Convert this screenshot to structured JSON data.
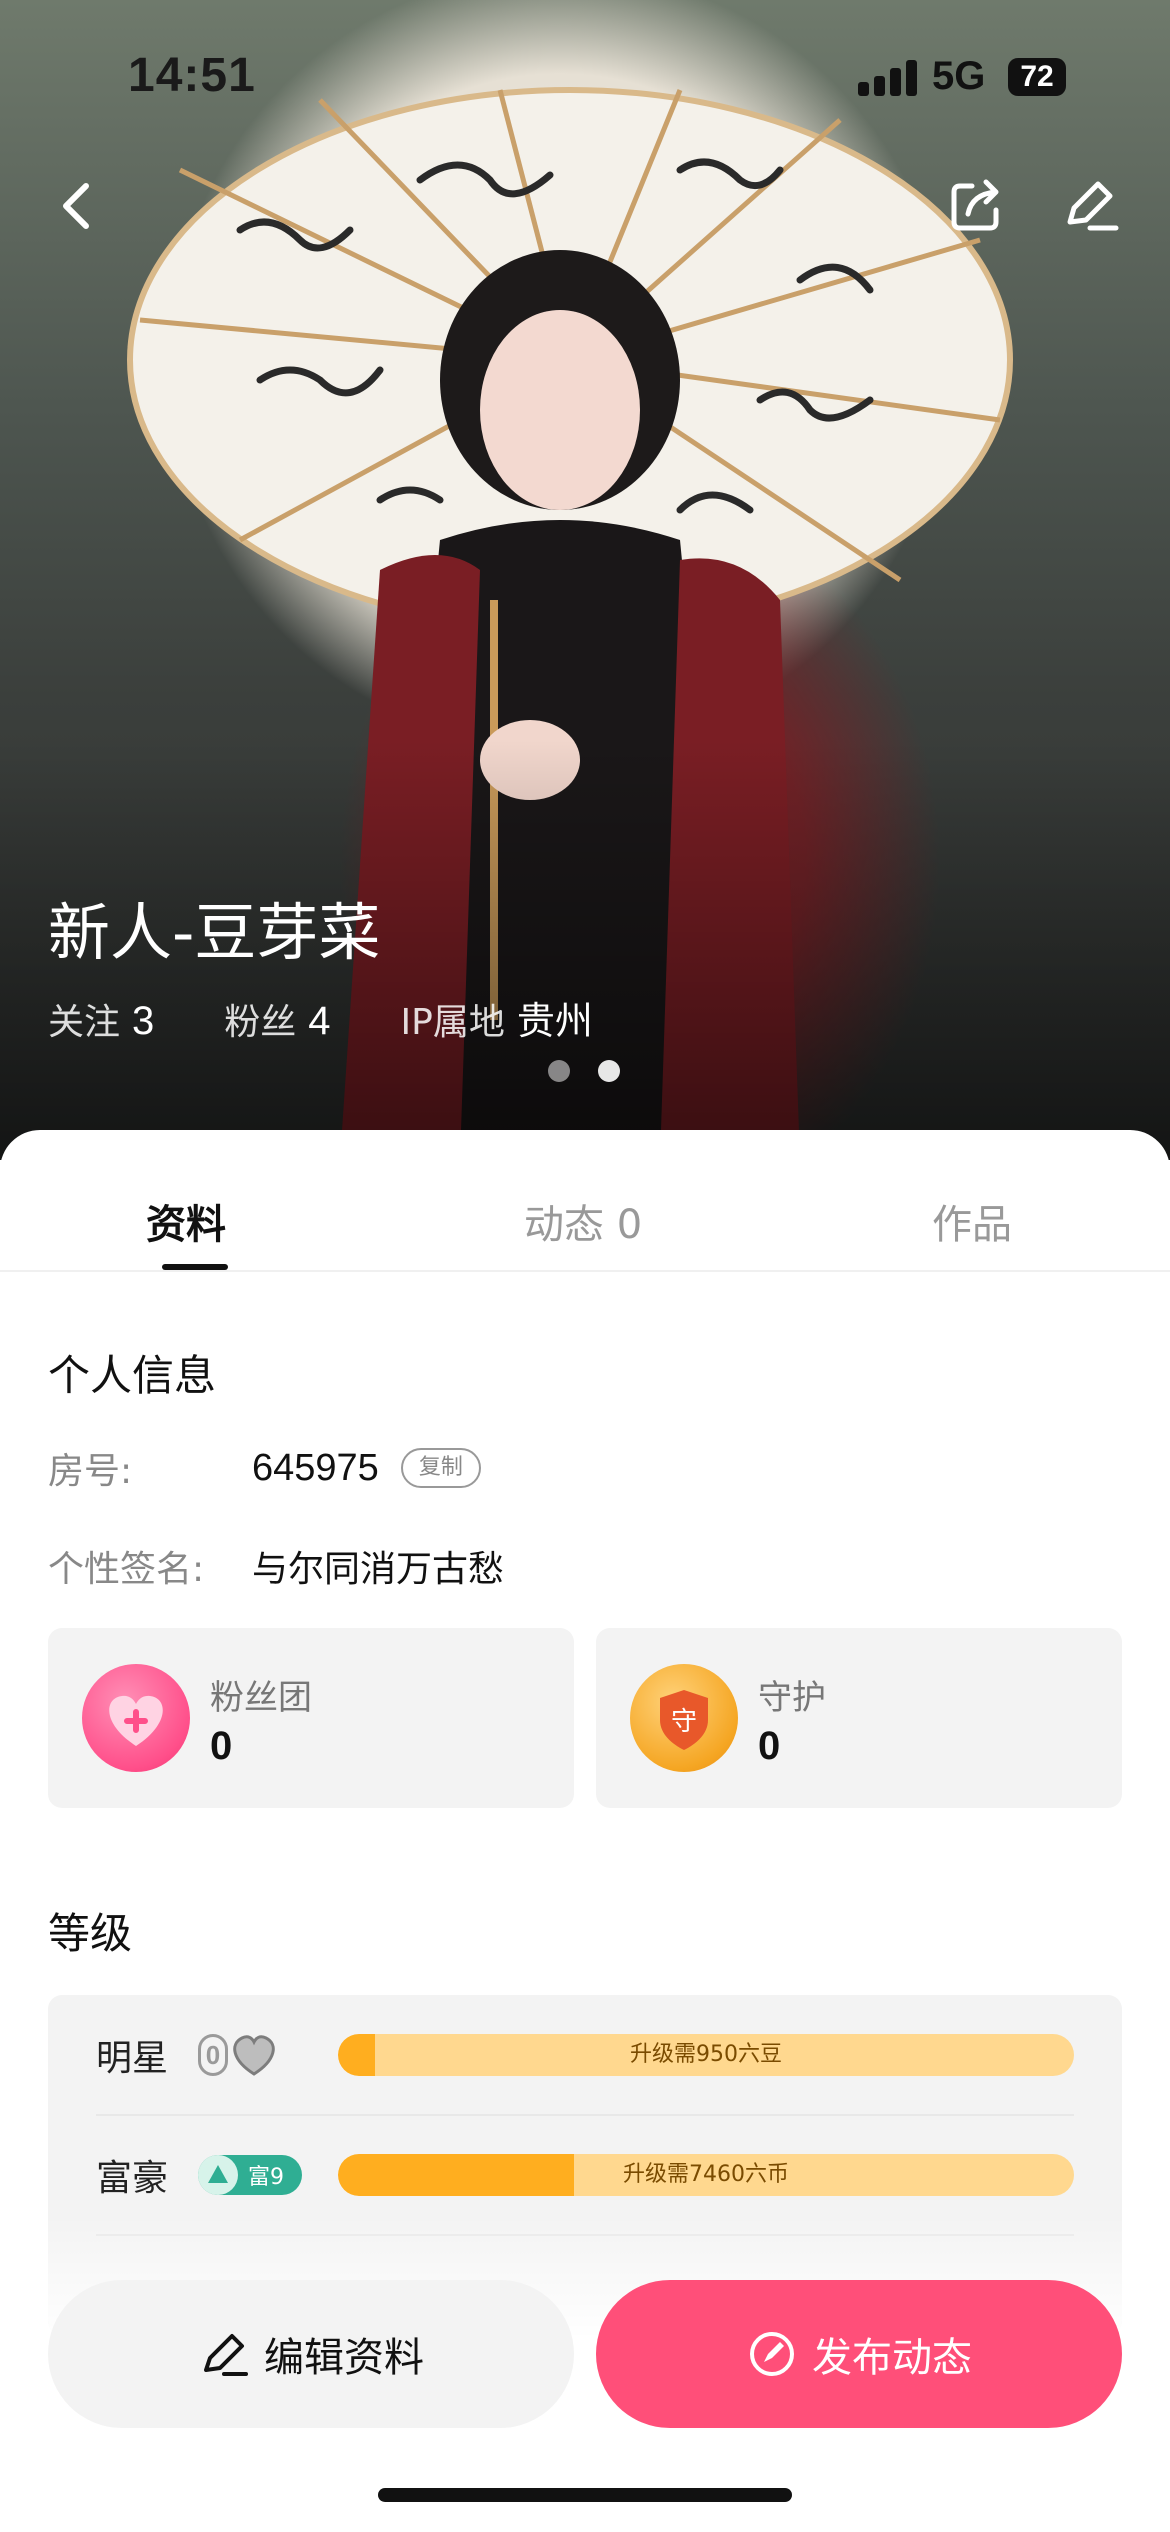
{
  "status_bar": {
    "time": "14:51",
    "network": "5G",
    "battery": "72"
  },
  "profile": {
    "name": "新人-豆芽菜",
    "stats": [
      {
        "label": "关注",
        "value": "3"
      },
      {
        "label": "粉丝",
        "value": "4"
      },
      {
        "label": "IP属地",
        "value": "贵州"
      }
    ],
    "carousel": {
      "count": 2,
      "active_index": 1
    }
  },
  "tabs": [
    {
      "label": "资料",
      "active": true
    },
    {
      "label": "动态 0",
      "active": false
    },
    {
      "label": "作品",
      "active": false
    }
  ],
  "personal_info": {
    "title": "个人信息",
    "room_label": "房号:",
    "room_value": "645975",
    "copy_label": "复制",
    "signature_label": "个性签名:",
    "signature_value": "与尔同消万古愁"
  },
  "cards": {
    "fan_club": {
      "title": "粉丝团",
      "value": "0",
      "icon": "heart-badge-icon"
    },
    "guard": {
      "title": "守护",
      "value": "0",
      "icon": "guard-shield-icon",
      "glyph": "守"
    }
  },
  "levels": {
    "title": "等级",
    "rows": [
      {
        "name": "明星",
        "badge_level": "0",
        "progress": 0.05,
        "progress_text": "升级需950六豆"
      },
      {
        "name": "富豪",
        "badge_text": "富9",
        "progress": 0.32,
        "progress_text": "升级需7460六币"
      }
    ]
  },
  "actions": {
    "edit_label": "编辑资料",
    "post_label": "发布动态"
  },
  "colors": {
    "accent": "#ff4f79",
    "progress_fill": "#ffae1f",
    "progress_track": "#ffd88f",
    "rich_badge": "#2fae93"
  }
}
